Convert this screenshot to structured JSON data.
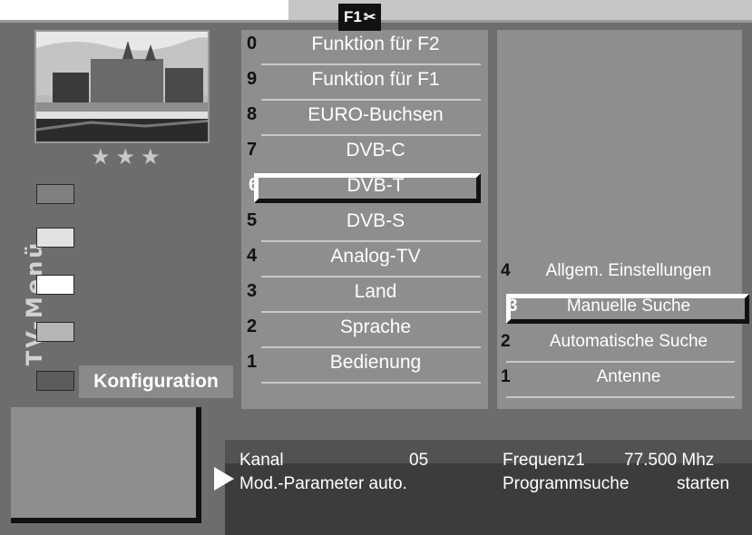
{
  "header": {
    "key_label": "F1",
    "key_icon": "scissors-icon"
  },
  "sidebar": {
    "title": "TV-Menü",
    "color_keys": [
      {
        "color": "#808080"
      },
      {
        "color": "#e2e2e2"
      },
      {
        "color": "#ffffff"
      },
      {
        "color": "#b6b6b6"
      },
      {
        "color": "#5c5c5c"
      }
    ],
    "active_label": "Konfiguration",
    "rating": "★★★"
  },
  "main_menu": {
    "items": [
      {
        "num": "0",
        "label": "Funktion für F2"
      },
      {
        "num": "9",
        "label": "Funktion für F1"
      },
      {
        "num": "8",
        "label": "EURO-Buchsen"
      },
      {
        "num": "7",
        "label": "DVB-C"
      },
      {
        "num": "6",
        "label": "DVB-T",
        "selected": true
      },
      {
        "num": "5",
        "label": "DVB-S"
      },
      {
        "num": "4",
        "label": "Analog-TV"
      },
      {
        "num": "3",
        "label": "Land"
      },
      {
        "num": "2",
        "label": "Sprache"
      },
      {
        "num": "1",
        "label": "Bedienung"
      }
    ]
  },
  "sub_menu": {
    "items": [
      {
        "num": "4",
        "label": "Allgem. Einstellungen"
      },
      {
        "num": "3",
        "label": "Manuelle Suche",
        "selected": true
      },
      {
        "num": "2",
        "label": "Automatische Suche"
      },
      {
        "num": "1",
        "label": "Antenne"
      }
    ]
  },
  "status": {
    "kanal_label": "Kanal",
    "kanal_value": "05",
    "frequenz_label": "Frequenz1",
    "frequenz_value": "77.500 Mhz",
    "mod_label": "Mod.-Parameter auto.",
    "suche_label": "Programmsuche",
    "suche_action": "starten"
  }
}
